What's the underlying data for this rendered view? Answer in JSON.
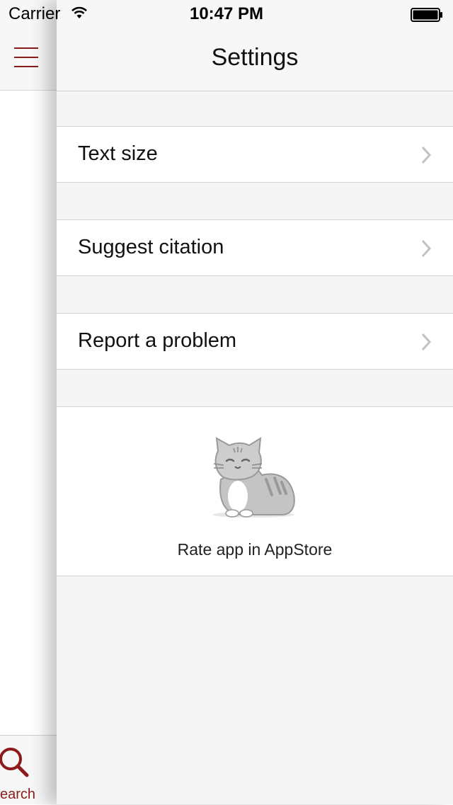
{
  "status_bar": {
    "carrier": "Carrier",
    "time": "10:47 PM",
    "wifi_icon": "wifi-icon",
    "battery_icon": "battery-icon"
  },
  "background_screen": {
    "menu_icon": "hamburger-menu-icon",
    "tab": {
      "label": "earch",
      "icon": "search-icon"
    },
    "accent_color": "#8b1a1a"
  },
  "settings": {
    "title": "Settings",
    "rows": [
      {
        "label": "Text size",
        "icon": "chevron-right-icon"
      },
      {
        "label": "Suggest citation",
        "icon": "chevron-right-icon"
      },
      {
        "label": "Report a problem",
        "icon": "chevron-right-icon"
      }
    ],
    "rate": {
      "label": "Rate app in AppStore",
      "icon": "cat-icon"
    }
  }
}
